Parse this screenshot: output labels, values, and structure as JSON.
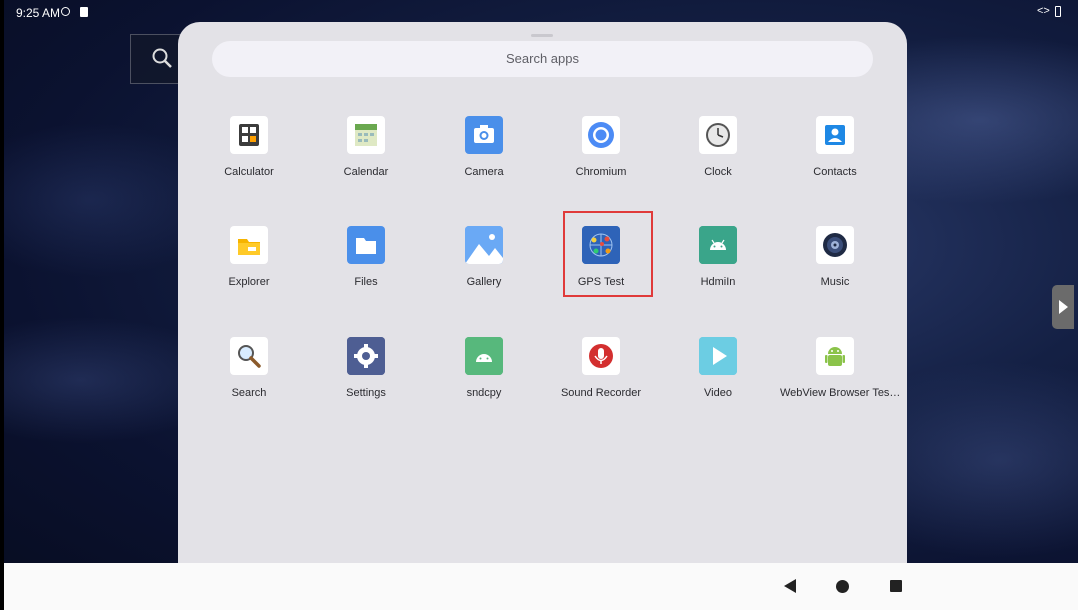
{
  "status_bar": {
    "time": "9:25 AM"
  },
  "search": {
    "placeholder": "Search apps"
  },
  "apps": [
    {
      "label": "Calculator",
      "icon": "calculator-icon"
    },
    {
      "label": "Calendar",
      "icon": "calendar-icon"
    },
    {
      "label": "Camera",
      "icon": "camera-icon"
    },
    {
      "label": "Chromium",
      "icon": "chromium-icon"
    },
    {
      "label": "Clock",
      "icon": "clock-icon"
    },
    {
      "label": "Contacts",
      "icon": "contacts-icon"
    },
    {
      "label": "Explorer",
      "icon": "explorer-icon"
    },
    {
      "label": "Files",
      "icon": "files-icon"
    },
    {
      "label": "Gallery",
      "icon": "gallery-icon"
    },
    {
      "label": "GPS Test",
      "icon": "gps-test-icon"
    },
    {
      "label": "HdmiIn",
      "icon": "hdmiin-icon"
    },
    {
      "label": "Music",
      "icon": "music-icon"
    },
    {
      "label": "Search",
      "icon": "search-icon"
    },
    {
      "label": "Settings",
      "icon": "settings-icon"
    },
    {
      "label": "sndcpy",
      "icon": "sndcpy-icon"
    },
    {
      "label": "Sound Recorder",
      "icon": "sound-recorder-icon"
    },
    {
      "label": "Video",
      "icon": "video-icon"
    },
    {
      "label": "WebView Browser Tes…",
      "icon": "webview-browser-tester-icon"
    }
  ],
  "selected_app": "GPS Test",
  "colors": {
    "highlight": "#e03a3a",
    "drawer_bg": "#e3e2e7"
  }
}
